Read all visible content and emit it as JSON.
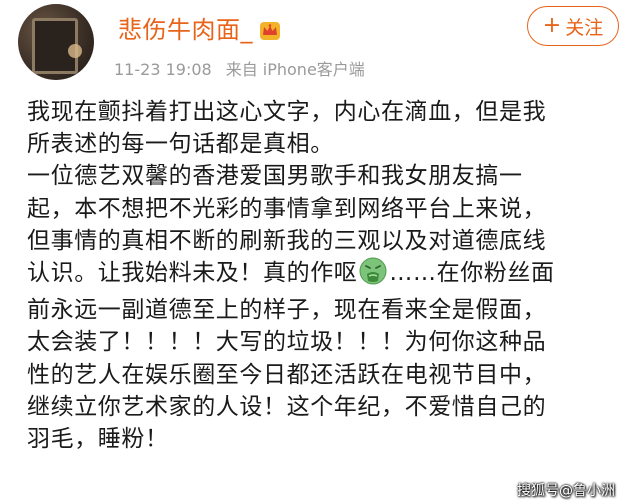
{
  "post": {
    "username": "悲伤牛肉面_",
    "badge_icon": "crown-icon",
    "timestamp": "11-23 19:08",
    "source": "来自 iPhone客户端",
    "follow_label": "关注",
    "follow_icon": "plus-icon",
    "accent_color": "#e8641a",
    "content_lines": [
      "我现在颤抖着打出这心文字，内心在滴血，但是我",
      "所表述的每一句话都是真相。",
      "一位德艺双馨的香港爱国男歌手和我女朋友搞一",
      "起，本不想把不光彩的事情拿到网络平台上来说，",
      "但事情的真相不断的刷新我的三观以及对道德底线",
      "认识。让我始料未及！真的作呕",
      "……在你粉丝面",
      "前永远一副道德至上的样子，现在看来全是假面，",
      "太会装了！！！！大写的垃圾！！！为何你这种品",
      "性的艺人在娱乐圈至今日都还活跃在电视节目中，",
      "继续立你艺术家的人设！这个年纪，不爱惜自己的",
      "羽毛，睡粉！"
    ],
    "emoji_icon": "vomit-emoji-icon"
  },
  "watermark": "搜狐号@鲁小洲"
}
